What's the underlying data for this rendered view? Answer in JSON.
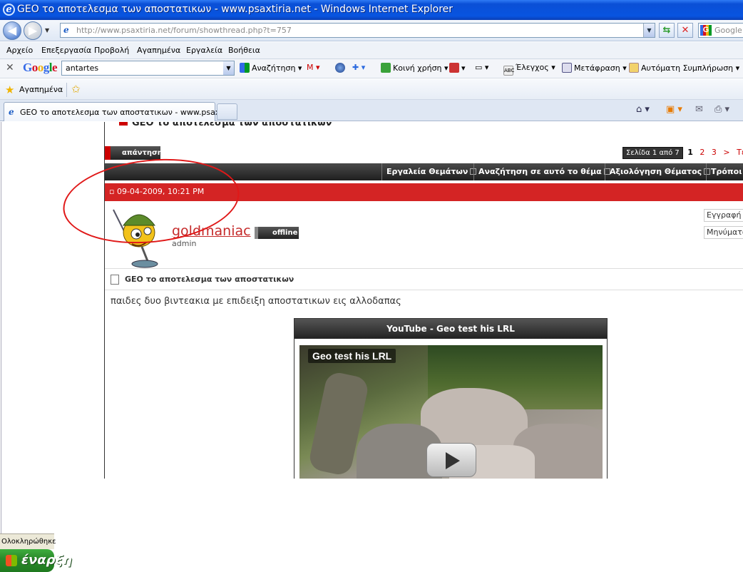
{
  "window": {
    "title": "GEO το αποτελεσμα των αποστατικων - www.psaxtiria.net - Windows Internet Explorer"
  },
  "address": {
    "url": "http://www.psaxtiria.net/forum/showthread.php?t=757",
    "search_placeholder": "Google"
  },
  "menu": [
    "Αρχείο",
    "Επεξεργασία",
    "Προβολή",
    "Αγαπημένα",
    "Εργαλεία",
    "Βοήθεια"
  ],
  "google_toolbar": {
    "logo": "Google",
    "query": "antartes",
    "search_label": "Αναζήτηση",
    "share_label": "Κοινή χρήση",
    "check_label": "Έλεγχος",
    "translate_label": "Μετάφραση",
    "autofill_label": "Αυτόματη Συμπλήρωση"
  },
  "favorites": {
    "label": "Αγαπημένα"
  },
  "tab": {
    "title": "GEO το αποτελεσμα των αποστατικων - www.psaxtiri..."
  },
  "thread": {
    "title": "GEO το αποτελεσμα των αποστατικων",
    "reply_button": "απάντηση",
    "pager_label": "Σελίδα 1 από 7",
    "pages": [
      "1",
      "2",
      "3",
      ">",
      "Τελ"
    ],
    "tools": [
      "Εργαλεία Θεμάτων",
      "Αναζήτηση σε αυτό το θέμα",
      "Αξιολόγηση Θέματος",
      "Τρόποι ε"
    ]
  },
  "post": {
    "date": "09-04-2009, 10:21 PM",
    "username": "goldmaniac",
    "status": "offline",
    "role": "admin",
    "info": [
      "Εγγραφή",
      "Μηνύματα"
    ],
    "title": "GEO το αποτελεσμα των αποστατικων",
    "body": "παιδες δυο βιντεακια με επιδειξη αποστατικων εις αλλοδαπας",
    "video_header": "YouTube - Geo test his LRL",
    "video_title": "Geo test his LRL"
  },
  "status_bar": {
    "text": "Ολοκληρώθηκε"
  },
  "taskbar": {
    "start_label": "έναρξη"
  },
  "colors": {
    "accent_red": "#d42424",
    "title_blue": "#0854e0",
    "link_red": "#c52a2a"
  }
}
